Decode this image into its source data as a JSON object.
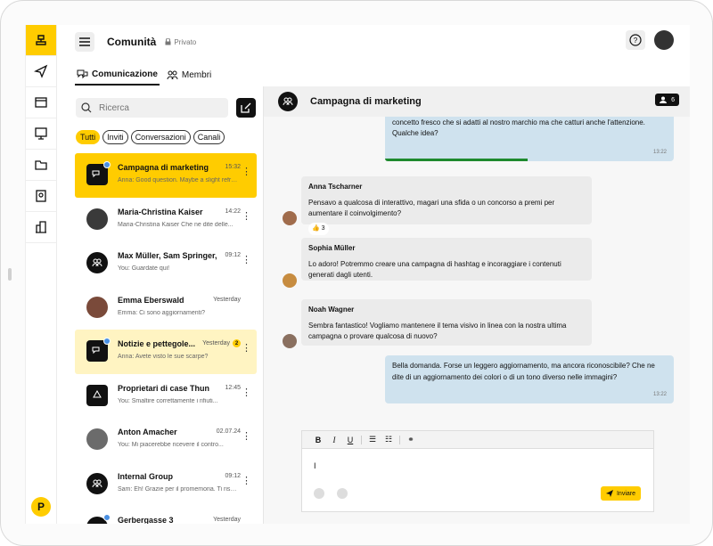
{
  "app": {
    "title": "Comunità",
    "privacy": "Privato"
  },
  "tabs": [
    {
      "label": "Comunicazione"
    },
    {
      "label": "Membri"
    }
  ],
  "search": {
    "placeholder": "Ricerca"
  },
  "filters": [
    "Tutti",
    "Inviti",
    "Conversazioni",
    "Canali"
  ],
  "conversations": [
    {
      "name": "Campagna di marketing",
      "time": "15:32",
      "preview": "Anna: Good question. Maybe a slight refres..."
    },
    {
      "name": "Maria-Christina Kaiser",
      "time": "14:22",
      "preview": "Maria-Christina Kaiser Che ne dite delle..."
    },
    {
      "name": "Max Müller, Sam Springer,...",
      "time": "09:12",
      "preview": "You: Guardate qui!"
    },
    {
      "name": "Emma Eberswald",
      "time": "Yesterday",
      "preview": "Emma: Ci sono aggiornamenti?"
    },
    {
      "name": "Notizie e pettegole...",
      "time": "Yesterday",
      "badge": "2",
      "preview": "Anna: Avete visto le sue scarpe?"
    },
    {
      "name": "Proprietari di case Thun",
      "time": "12:45",
      "preview": "You: Smaltire correttamente i rifiuti..."
    },
    {
      "name": "Anton Amacher",
      "time": "02.07.24",
      "preview": "You: Mi piacerebbe ricevere il contro..."
    },
    {
      "name": "Internal Group",
      "time": "09:12",
      "preview": "Sam: Eh! Grazie per il promemoria. Ti rispo..."
    },
    {
      "name": "Gerbergasse 3",
      "time": "Yesterday",
      "preview": ""
    }
  ],
  "chat": {
    "title": "Campagna di marketing",
    "member_count": "6",
    "messages": [
      {
        "text": "Ehi, squadra! Ci stiamo avvicinando alla campagna per il Q3. Abbiamo bisogno di un concetto fresco che si adatti al nostro marchio ma che catturi anche l'attenzione. Qualche idea?",
        "time": "13:22"
      },
      {
        "sender": "Anna Tscharner",
        "text": "Pensavo a qualcosa di interattivo, magari una sfida o un concorso a premi per aumentare il coinvolgimento?",
        "reaction": "👍 3"
      },
      {
        "sender": "Sophia Müller",
        "text": "Lo adoro! Potremmo creare una campagna di hashtag e incoraggiare i contenuti generati dagli utenti."
      },
      {
        "sender": "Noah Wagner",
        "text": "Sembra fantastico! Vogliamo mantenere il tema visivo in linea con la nostra ultima campagna o provare qualcosa di nuovo?"
      },
      {
        "text": "Bella domanda. Forse un leggero aggiornamento, ma ancora riconoscibile? Che ne dite di un aggiornamento dei colori o di un tono diverso nelle immagini?",
        "time": "13:22"
      }
    ]
  },
  "composer": {
    "draft": "I",
    "send_label": "Inviare"
  },
  "colors": {
    "accent": "#ffcc00",
    "outgoing": "#cfe2ee",
    "incoming": "#ebebeb",
    "progress": "#1e8a2e"
  }
}
